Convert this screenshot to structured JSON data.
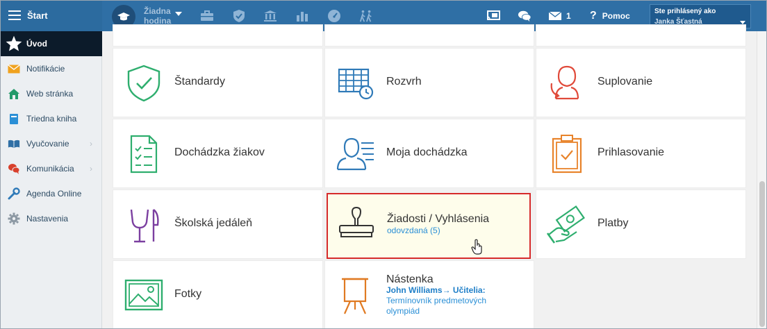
{
  "topbar": {
    "start_label": "Štart",
    "lesson_line1": "Žiadna",
    "lesson_line2": "hodina",
    "messages_count": "1",
    "help_label": "Pomoc",
    "user_line1": "Ste prihlásený ako",
    "user_line2": "Janka Šťastná"
  },
  "sidebar": {
    "items": [
      {
        "label": "Úvod",
        "icon": "star-icon"
      },
      {
        "label": "Notifikácie",
        "icon": "envelope-icon"
      },
      {
        "label": "Web stránka",
        "icon": "home-icon"
      },
      {
        "label": "Triedna kniha",
        "icon": "book-icon"
      },
      {
        "label": "Vyučovanie",
        "icon": "open-book-icon"
      },
      {
        "label": "Komunikácia",
        "icon": "chat-icon"
      },
      {
        "label": "Agenda Online",
        "icon": "wrench-icon"
      },
      {
        "label": "Nastavenia",
        "icon": "gear-icon"
      }
    ]
  },
  "tiles": {
    "standardy": {
      "title": "Štandardy",
      "icon": "shield-check-icon",
      "color": "#2eae6e"
    },
    "rozvrh": {
      "title": "Rozvrh",
      "icon": "timetable-icon",
      "color": "#2f7ab8"
    },
    "suplovanie": {
      "title": "Suplovanie",
      "icon": "substitute-person-icon",
      "color": "#e04a3a"
    },
    "dochadzka": {
      "title": "Dochádzka žiakov",
      "icon": "attendance-list-icon",
      "color": "#2eae6e"
    },
    "moja_dochadzka": {
      "title": "Moja dochádzka",
      "icon": "person-list-icon",
      "color": "#2f7ab8"
    },
    "prihlasovanie": {
      "title": "Prihlasovanie",
      "icon": "clipboard-check-icon",
      "color": "#e8832a"
    },
    "jedalen": {
      "title": "Školská jedáleň",
      "icon": "cutlery-icon",
      "color": "#7b3fa0"
    },
    "ziadosti": {
      "title": "Žiadosti / Vyhlásenia",
      "subtitle": "odovzdaná (5)",
      "icon": "stamp-icon",
      "color": "#333333"
    },
    "platby": {
      "title": "Platby",
      "icon": "money-hand-icon",
      "color": "#2eae6e"
    },
    "fotky": {
      "title": "Fotky",
      "icon": "photo-icon",
      "color": "#2eae6e"
    },
    "nastenka": {
      "title": "Nástenka",
      "author": "John Williams→ Učitelia:",
      "text1": "Termínovník predmetových",
      "text2": "olympiád",
      "icon": "easel-icon",
      "color": "#e07a22"
    }
  }
}
